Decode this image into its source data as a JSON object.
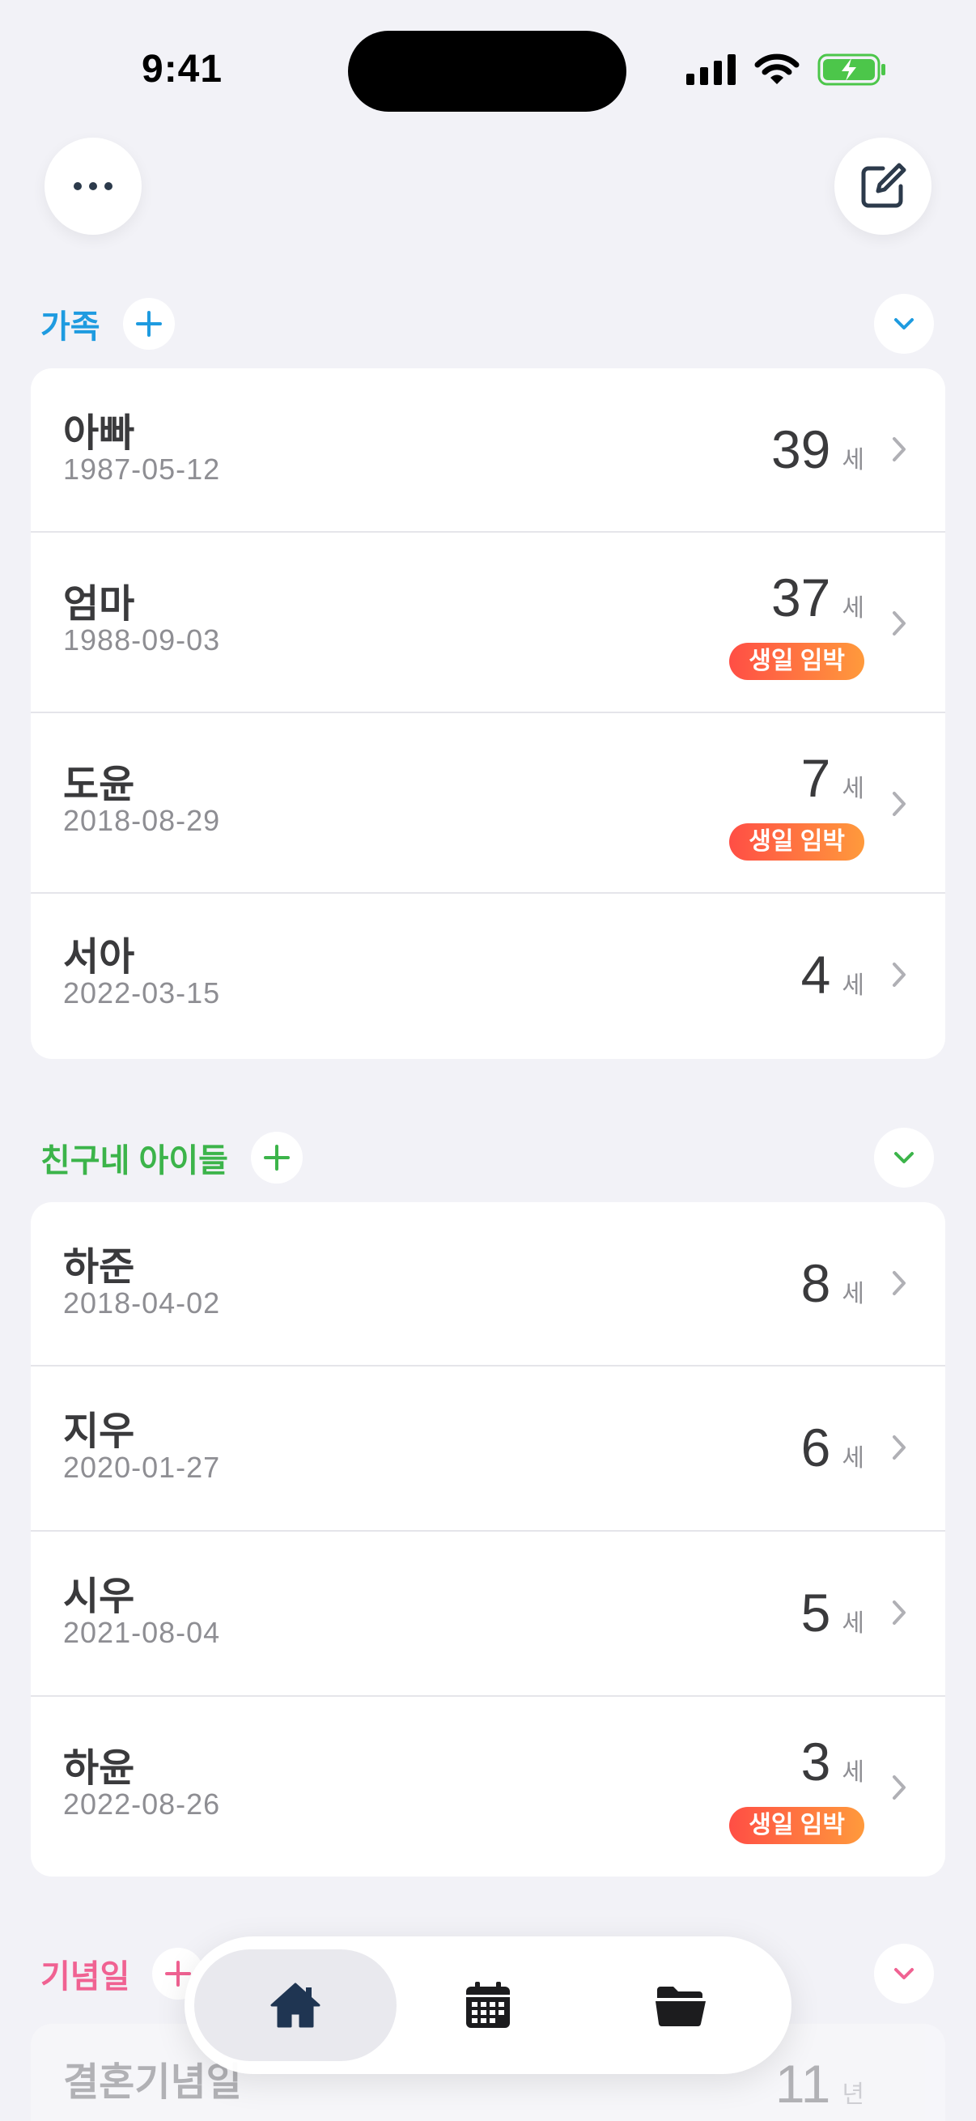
{
  "status": {
    "time": "9:41"
  },
  "colors": {
    "family": "#1E9BE0",
    "friends": "#3CB44A",
    "anniv": "#F06292",
    "badge_start": "#FF4E45",
    "badge_end": "#FF9A3C"
  },
  "toolbar": {
    "more_icon": "ellipsis-icon",
    "edit_icon": "compose-icon"
  },
  "sections": [
    {
      "title": "가족",
      "rows": [
        {
          "name": "아빠",
          "date": "1987-05-12",
          "age": "39",
          "unit": "세",
          "badge": ""
        },
        {
          "name": "엄마",
          "date": "1988-09-03",
          "age": "37",
          "unit": "세",
          "badge": "생일 임박"
        },
        {
          "name": "도윤",
          "date": "2018-08-29",
          "age": "7",
          "unit": "세",
          "badge": "생일 임박"
        },
        {
          "name": "서아",
          "date": "2022-03-15",
          "age": "4",
          "unit": "세",
          "badge": ""
        }
      ]
    },
    {
      "title": "친구네 아이들",
      "rows": [
        {
          "name": "하준",
          "date": "2018-04-02",
          "age": "8",
          "unit": "세",
          "badge": ""
        },
        {
          "name": "지우",
          "date": "2020-01-27",
          "age": "6",
          "unit": "세",
          "badge": ""
        },
        {
          "name": "시우",
          "date": "2021-08-04",
          "age": "5",
          "unit": "세",
          "badge": ""
        },
        {
          "name": "하윤",
          "date": "2022-08-26",
          "age": "3",
          "unit": "세",
          "badge": "생일 임박"
        }
      ]
    },
    {
      "title": "기념일",
      "rows": [
        {
          "name": "결혼기념일",
          "age": "11",
          "unit": "년"
        }
      ]
    }
  ],
  "tabbar": {
    "tabs": [
      {
        "icon": "house-icon"
      },
      {
        "icon": "calendar-icon"
      },
      {
        "icon": "folder-icon"
      }
    ]
  }
}
